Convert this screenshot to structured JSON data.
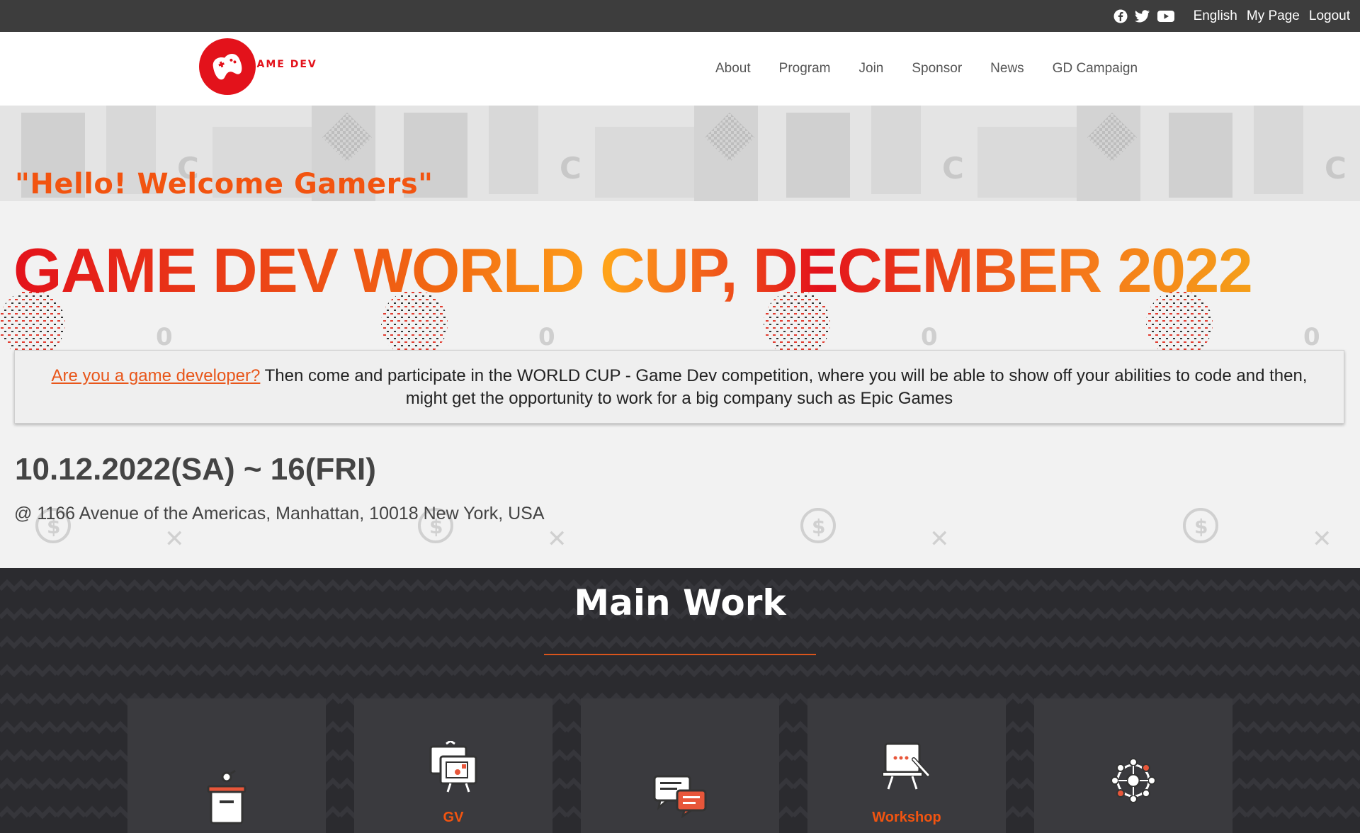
{
  "topbar": {
    "social": [
      "facebook-icon",
      "twitter-icon",
      "youtube-icon"
    ],
    "links": {
      "language": "English",
      "mypage": "My Page",
      "logout": "Logout"
    }
  },
  "header": {
    "logo_text": "GAME DEV",
    "nav": [
      "About",
      "Program",
      "Join",
      "Sponsor",
      "News",
      "GD Campaign"
    ]
  },
  "hero": {
    "greeting": "\"Hello! Welcome Gamers\"",
    "title": "GAME DEV WORLD CUP, DECEMBER 2022",
    "notice_link": "Are you a game developer?",
    "notice_text": " Then come and participate in the WORLD CUP - Game Dev competition, where you will be able to show off your abilities to code and then, might get the opportunity to work for a big company such as Epic Games",
    "dates": "10.12.2022(SA) ~ 16(FRI)",
    "address": "@ 1166 Avenue of the Americas, Manhattan, 10018 New York, USA"
  },
  "main_work": {
    "title": "Main Work",
    "cards": [
      {
        "icon": "podium-icon",
        "label": ""
      },
      {
        "icon": "exhibition-icon",
        "label": "GV"
      },
      {
        "icon": "chat-icon",
        "label": ""
      },
      {
        "icon": "workshop-icon",
        "label": "Workshop"
      },
      {
        "icon": "network-icon",
        "label": ""
      }
    ]
  },
  "colors": {
    "accent": "#f25410",
    "brand_red": "#e3121b",
    "topbar": "#3d3d3d",
    "dark_section": "#2b2b2f"
  }
}
